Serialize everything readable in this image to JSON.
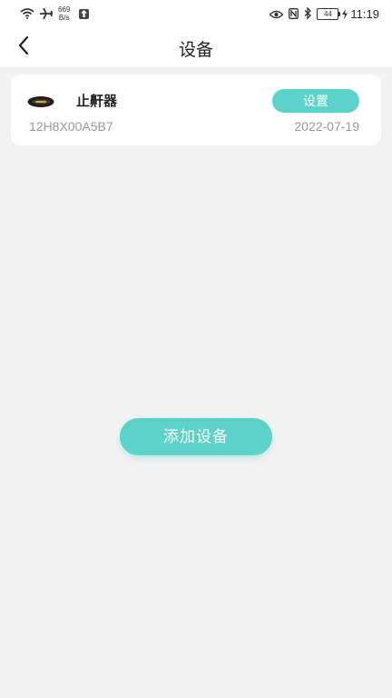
{
  "status_bar": {
    "net_speed_value": "669",
    "net_speed_unit": "B/s",
    "battery_level": "44",
    "time": "11:19",
    "icons": [
      "wifi-icon",
      "airplane-icon",
      "upload-icon",
      "eye-icon",
      "nfc-icon",
      "bluetooth-icon",
      "battery-icon",
      "charging-icon"
    ]
  },
  "header": {
    "title": "设备",
    "back_icon": "chevron-left-icon"
  },
  "device": {
    "name": "止鼾器",
    "settings_label": "设置",
    "serial": "12H8X00A5B7",
    "date": "2022-07-19",
    "thumb_icon": "sleep-mask-icon"
  },
  "actions": {
    "add_device_label": "添加设备"
  },
  "colors": {
    "accent": "#5cd3c9",
    "background": "#f2f2f2",
    "card": "#ffffff",
    "muted_text": "#999999"
  }
}
